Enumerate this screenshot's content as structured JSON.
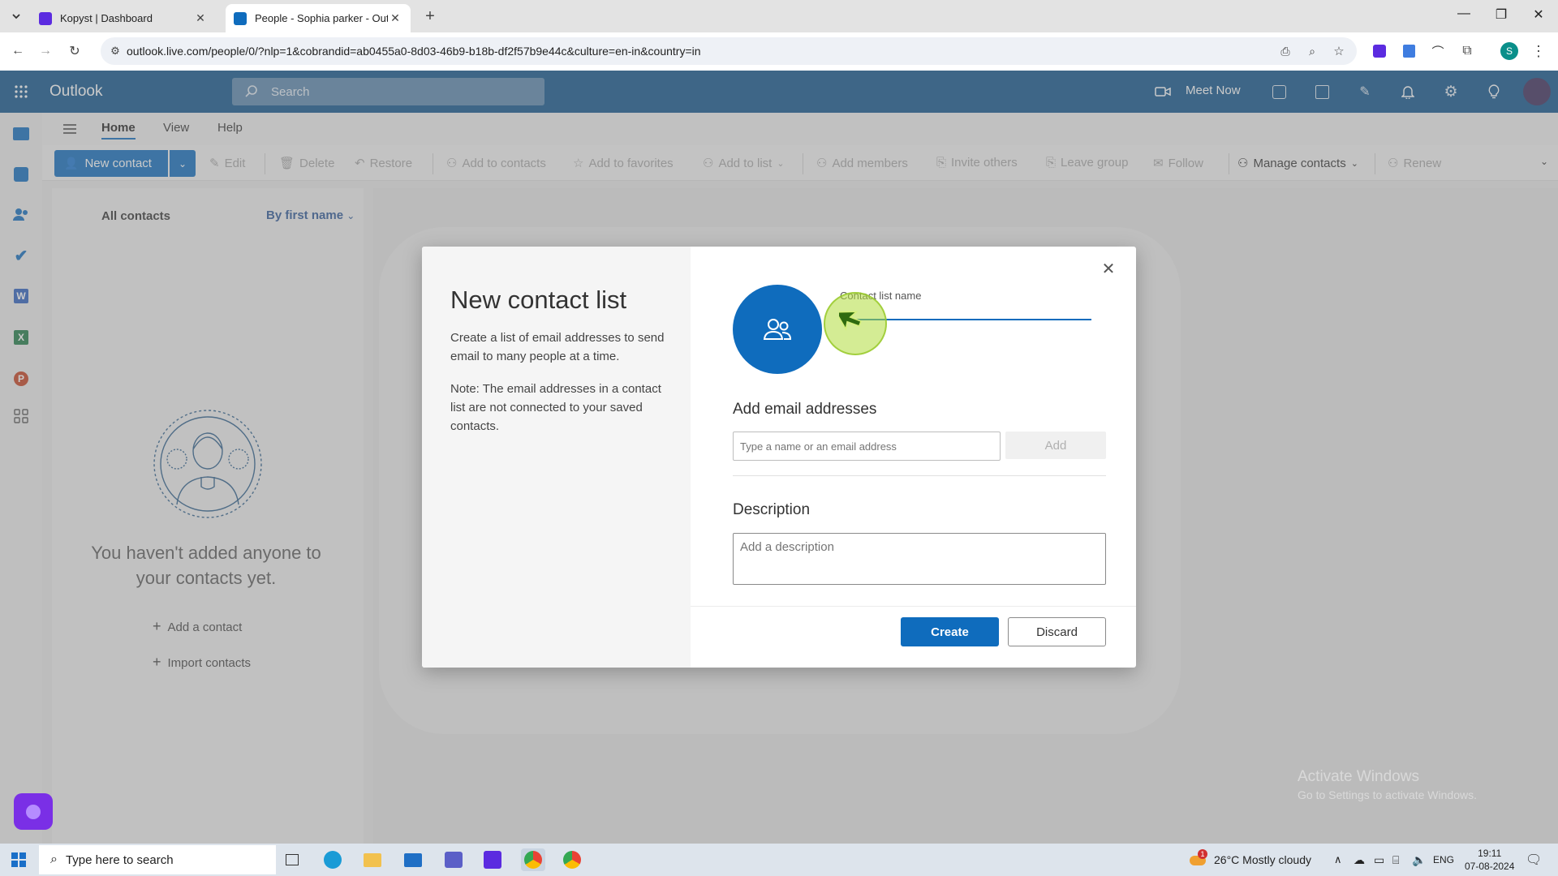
{
  "browser": {
    "tabs": [
      {
        "title": "Kopyst | Dashboard",
        "active": false
      },
      {
        "title": "People - Sophia parker - Outlo",
        "active": true
      }
    ],
    "url": "outlook.live.com/people/0/?nlp=1&cobrandid=ab0455a0-8d03-46b9-b18b-df2f57b9e44c&culture=en-in&country=in",
    "profile_initial": "S"
  },
  "outlook": {
    "brand": "Outlook",
    "search_placeholder": "Search",
    "meet_now": "Meet Now"
  },
  "ribbon": {
    "tabs": [
      "Home",
      "View",
      "Help"
    ],
    "active_tab": "Home",
    "new_contact": "New contact",
    "actions": {
      "edit": "Edit",
      "delete": "Delete",
      "restore": "Restore",
      "add_to_contacts": "Add to contacts",
      "add_to_favorites": "Add to favorites",
      "add_to_list": "Add to list",
      "add_members": "Add members",
      "invite_others": "Invite others",
      "leave_group": "Leave group",
      "follow": "Follow",
      "manage_contacts": "Manage contacts",
      "renew": "Renew"
    }
  },
  "contacts": {
    "all_contacts": "All contacts",
    "sort": "By first name",
    "empty_message": "You haven't added anyone to your contacts yet.",
    "add_contact": "Add a contact",
    "import_contacts": "Import contacts"
  },
  "dialog": {
    "title": "New contact list",
    "description": "Create a list of email addresses to send email to many people at a time.",
    "note": "Note: The email addresses in a contact list are not connected to your saved contacts.",
    "list_name_label": "Contact list name",
    "list_name_value": "",
    "add_emails_heading": "Add email addresses",
    "email_placeholder": "Type a name or an email address",
    "add_button": "Add",
    "description_heading": "Description",
    "description_placeholder": "Add a description",
    "create_button": "Create",
    "discard_button": "Discard"
  },
  "watermark": {
    "line1": "Activate Windows",
    "line2": "Go to Settings to activate Windows."
  },
  "taskbar": {
    "search_placeholder": "Type here to search",
    "weather": "26°C  Mostly cloudy",
    "weather_badge": "1",
    "language": "ENG",
    "time": "19:11",
    "date": "07-08-2024"
  },
  "colors": {
    "outlook_header": "#0f548c",
    "accent": "#0f6cbd",
    "cursor_highlight": "#b0dc3c"
  }
}
